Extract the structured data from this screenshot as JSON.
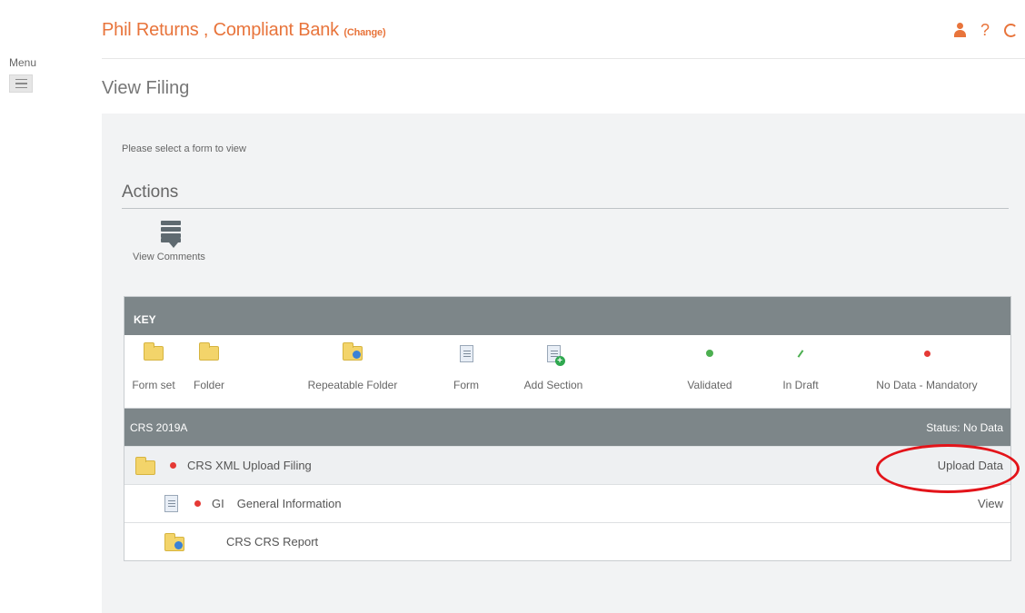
{
  "menu": {
    "label": "Menu"
  },
  "header": {
    "brand": "Phil Returns , Compliant Bank",
    "change_link": "(Change)",
    "help_glyph": "?"
  },
  "page": {
    "title": "View Filing"
  },
  "panel": {
    "instruction": "Please select a form to view",
    "actions_title": "Actions",
    "view_comments_label": "View Comments"
  },
  "key": {
    "header": "KEY",
    "items": [
      {
        "label": "Form set",
        "icon": "form-set-icon"
      },
      {
        "label": "Folder",
        "icon": "folder-icon"
      },
      {
        "label": "Repeatable Folder",
        "icon": "repeatable-folder-icon"
      },
      {
        "label": "Form",
        "icon": "form-icon"
      },
      {
        "label": "Add Section",
        "icon": "add-section-icon"
      },
      {
        "label": "Validated",
        "icon": "validated-icon"
      },
      {
        "label": "In Draft",
        "icon": "in-draft-icon"
      },
      {
        "label": "No Data - Mandatory",
        "icon": "no-data-mandatory-icon"
      }
    ]
  },
  "filing": {
    "section_name": "CRS 2019A",
    "status": "Status: No Data",
    "rows": [
      {
        "label": "CRS XML Upload Filing",
        "action": "Upload Data"
      },
      {
        "code": "GI",
        "label": "General Information",
        "action": "View"
      },
      {
        "label": "CRS CRS Report"
      }
    ]
  },
  "colors": {
    "brand": "#e8743b",
    "table_header": "#7d8689",
    "annotation": "#e3141a"
  }
}
